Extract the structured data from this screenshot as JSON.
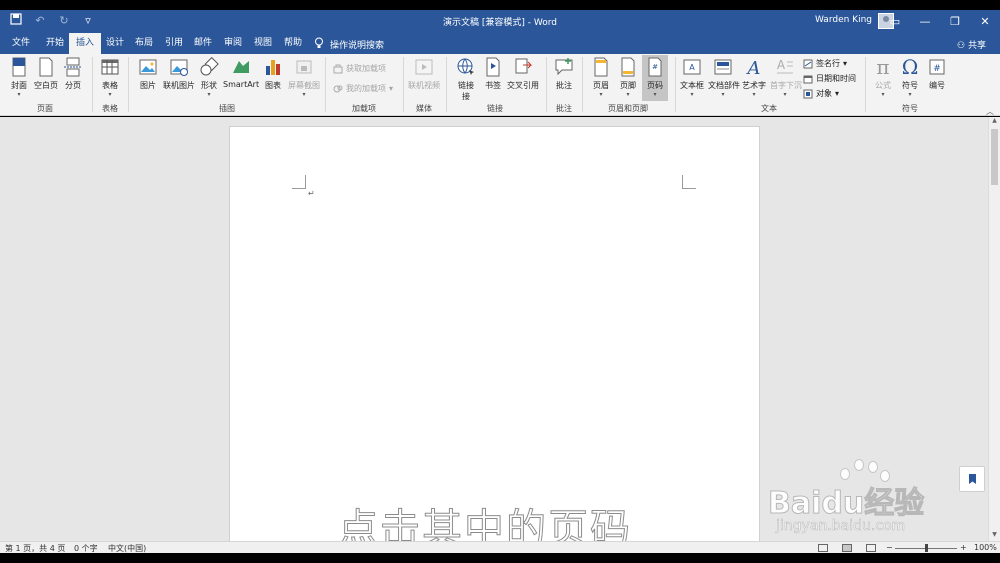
{
  "titlebar": {
    "doc_title": "演示文稿 [兼容模式] - Word",
    "user_name": "Warden King",
    "qat": [
      "save-icon",
      "undo-icon",
      "redo-icon",
      "customize-icon"
    ],
    "window_buttons": [
      "▭",
      "—",
      "❐",
      "✕"
    ]
  },
  "tabs": [
    "文件",
    "开始",
    "插入",
    "设计",
    "布局",
    "引用",
    "邮件",
    "审阅",
    "视图",
    "帮助"
  ],
  "active_tab": "插入",
  "tellme": "操作说明搜索",
  "share": "共享",
  "ribbon": {
    "cover": "封面",
    "blank_page": "空白页",
    "page_break": "分页",
    "table": "表格",
    "picture": "图片",
    "online_picture": "联机图片",
    "shapes": "形状",
    "smartart": "SmartArt",
    "chart": "图表",
    "screenshot": "屏幕截图",
    "get_addins": "获取加载项",
    "my_addins": "我的加载项",
    "online_video": "联机视频",
    "link": "链接",
    "link2": "接",
    "bookmark": "书签",
    "cross_ref": "交叉引用",
    "comment": "批注",
    "header": "页眉",
    "footer": "页脚",
    "page_number": "页码",
    "textbox": "文本框",
    "quick_parts": "文档部件",
    "wordart": "艺术字",
    "dropcap": "首字下沉",
    "signature_line": "签名行",
    "date_time": "日期和时间",
    "object": "对象",
    "equation": "公式",
    "symbol": "符号",
    "numbering": "编号",
    "groups": {
      "pages": "页面",
      "tables": "表格",
      "illustrations": "插图",
      "addins": "加载项",
      "media": "媒体",
      "links": "链接",
      "comments": "批注",
      "header_footer": "页眉和页脚",
      "text": "文本",
      "symbols": "符号"
    }
  },
  "document": {
    "caption": "点击其中的页码",
    "paragraph_mark": "↵"
  },
  "status": {
    "page": "第 1 页，共 4 页",
    "words": "0 个字",
    "language": "中文(中国)",
    "zoom": "100%",
    "zoom_minus": "−",
    "zoom_plus": "+"
  },
  "watermark": {
    "main": "Baidu经验",
    "sub": "jingyan.baidu.com"
  },
  "colors": {
    "accent": "#2b579a",
    "ribbon_bg": "#f3f3f3",
    "canvas_bg": "#e6e6e6"
  }
}
